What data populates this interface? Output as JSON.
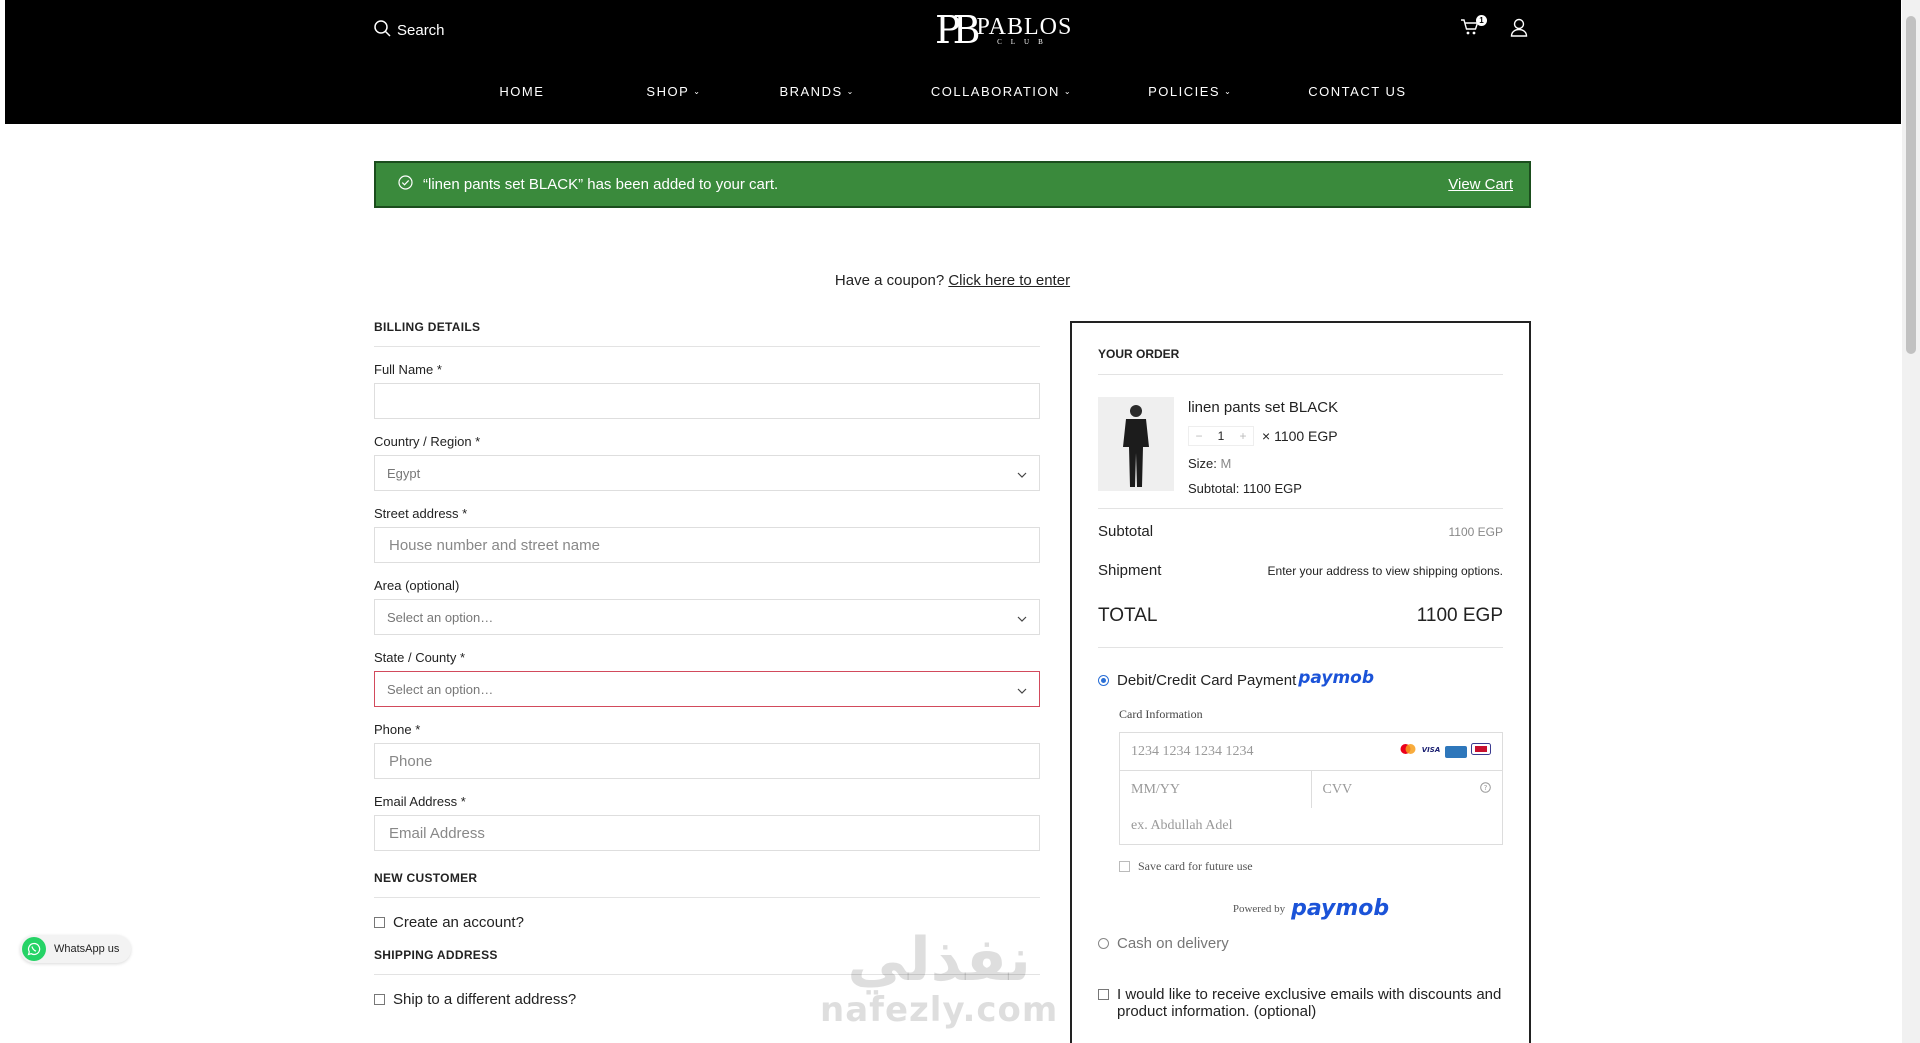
{
  "header": {
    "search_label": "Search",
    "logo_main": "PABLOS",
    "logo_sub": "CLUB",
    "logo_mark": "PB",
    "cart_count": "1",
    "nav": [
      {
        "label": "HOME"
      },
      {
        "label": "SHOP"
      },
      {
        "label": "BRANDS"
      },
      {
        "label": "COLLABORATION"
      },
      {
        "label": "POLICIES"
      },
      {
        "label": "CONTACT US"
      }
    ]
  },
  "notice": {
    "message": "“linen pants set BLACK” has been added to your cart.",
    "link": "View Cart",
    "color": "#3a8a3c"
  },
  "coupon": {
    "text": "Have a coupon?",
    "link": "Click here to enter"
  },
  "billing": {
    "title": "BILLING DETAILS",
    "full_name_label": "Full Name *",
    "country_label": "Country / Region *",
    "country_value": "Egypt",
    "street_label": "Street address *",
    "street_placeholder": "House number and street name",
    "area_label": "Area (optional)",
    "area_value": "Select an option…",
    "state_label": "State / County *",
    "state_value": "Select an option…",
    "phone_label": "Phone *",
    "phone_placeholder": "Phone",
    "email_label": "Email Address *",
    "email_placeholder": "Email Address",
    "new_customer_title": "NEW CUSTOMER",
    "create_account": "Create an account?",
    "shipping_title": "SHIPPING ADDRESS",
    "ship_different": "Ship to a different address?"
  },
  "order": {
    "title": "YOUR ORDER",
    "product_name": "linen pants set BLACK",
    "qty": "1",
    "qty_minus": "−",
    "qty_plus": "+",
    "price_line": "× 1100 EGP",
    "size_label": "Size:",
    "size_value": "M",
    "subtotal_line": "Subtotal: 1100 EGP",
    "subtotal_label": "Subtotal",
    "subtotal_value": "1100 EGP",
    "shipment_label": "Shipment",
    "shipment_value": "Enter your address to view shipping options.",
    "total_label": "TOTAL",
    "total_value": "1100 EGP"
  },
  "payment": {
    "card_option": "Debit/Credit Card Payment",
    "paymob": "paymob",
    "card_info_label": "Card Information",
    "card_number_placeholder": "1234 1234 1234 1234",
    "expiry_placeholder": "MM/YY",
    "cvv_placeholder": "CVV",
    "name_placeholder": "ex. Abdullah Adel",
    "save_card": "Save card for future use",
    "powered_by": "Powered by",
    "cod_option": "Cash on delivery",
    "emails_opt": "I would like to receive exclusive emails with discounts and product information. (optional)",
    "accent": "#1b53d8"
  },
  "whatsapp": {
    "label": "WhatsApp us"
  },
  "watermark": {
    "arabic": "نفذلي",
    "latin": "nafezly.com"
  }
}
